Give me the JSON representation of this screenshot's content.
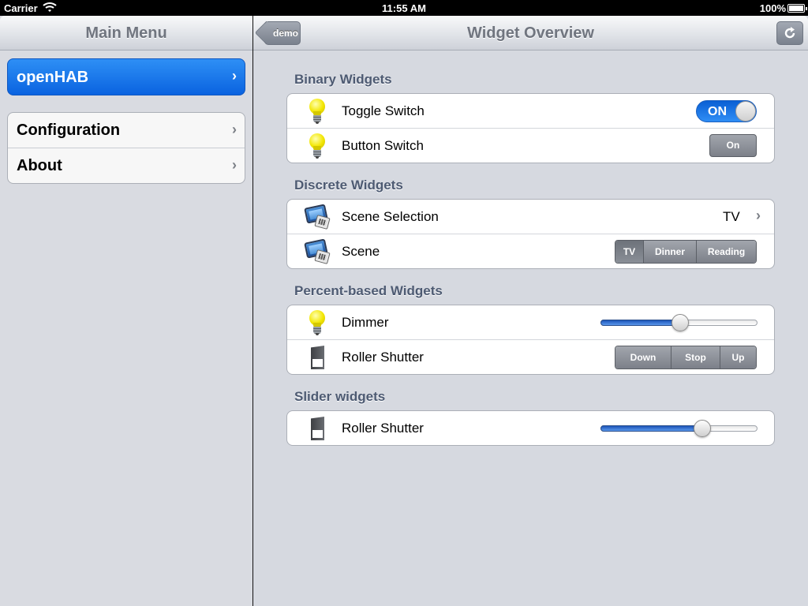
{
  "status_bar": {
    "carrier": "Carrier",
    "time": "11:55 AM",
    "battery": "100%"
  },
  "main_menu": {
    "title": "Main Menu",
    "primary_item": "openHAB",
    "items": [
      {
        "label": "Configuration"
      },
      {
        "label": "About"
      }
    ]
  },
  "detail": {
    "title": "Widget Overview",
    "back_label": "demo",
    "refresh_icon": "refresh-icon"
  },
  "sections": {
    "binary": {
      "header": "Binary Widgets",
      "toggle": {
        "label": "Toggle Switch",
        "state": "ON",
        "on": true
      },
      "button": {
        "label": "Button Switch",
        "button_label": "On"
      }
    },
    "discrete": {
      "header": "Discrete Widgets",
      "scene_selection": {
        "label": "Scene Selection",
        "value": "TV"
      },
      "scene": {
        "label": "Scene",
        "options": [
          "TV",
          "Dinner",
          "Reading"
        ],
        "selected": "TV"
      }
    },
    "percent": {
      "header": "Percent-based Widgets",
      "dimmer": {
        "label": "Dimmer",
        "level": 0.51
      },
      "roller": {
        "label": "Roller Shutter",
        "options": [
          "Down",
          "Stop",
          "Up"
        ]
      }
    },
    "slider": {
      "header": "Slider widgets",
      "roller": {
        "label": "Roller Shutter",
        "level": 0.65
      }
    }
  },
  "colors": {
    "accent_blue": "#0a63e0",
    "section_header": "#4d5a72",
    "background": "#d6d9e0"
  }
}
